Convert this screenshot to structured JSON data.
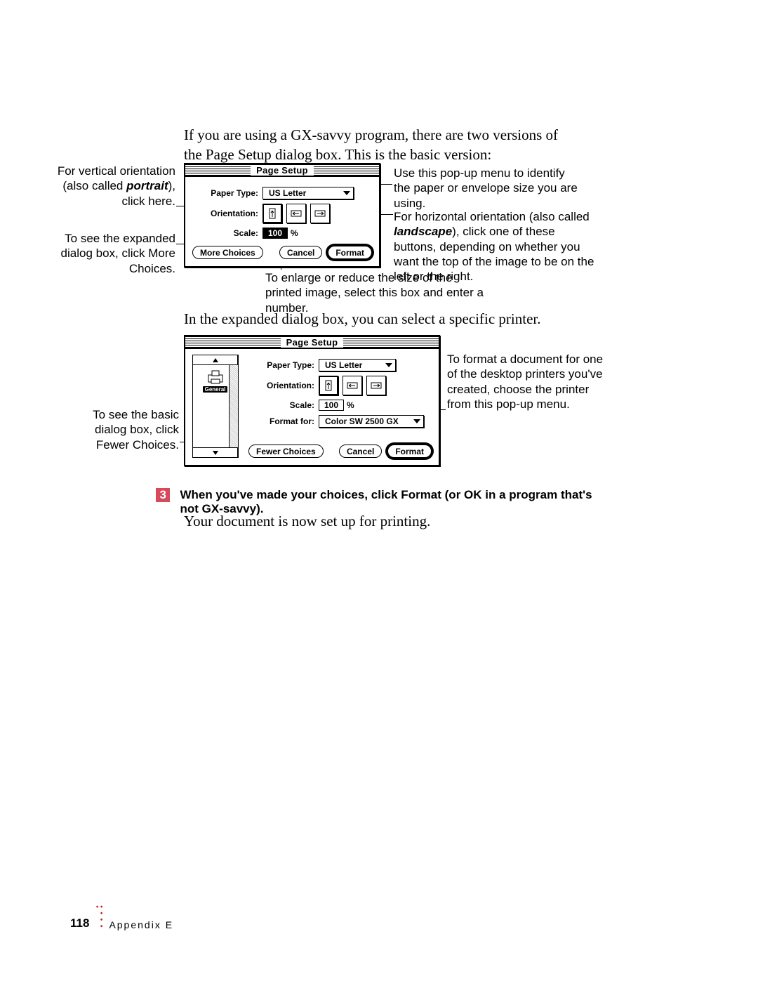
{
  "intro": "If you are using a GX-savvy program, there are two versions of the Page Setup dialog box. This is the basic version:",
  "callouts": {
    "portrait_pre": "For vertical orientation (also called ",
    "portrait_em": "portrait",
    "portrait_post": "), click here.",
    "more_choices": "To see the expanded dialog box, click More Choices.",
    "paper_popup": "Use this pop-up menu to identify the paper or envelope size you are using.",
    "landscape_pre": "For horizontal orientation (also called ",
    "landscape_em": "landscape",
    "landscape_post": "), click one of these buttons, depending on  whether you want the top of the image to be on the left or the right.",
    "scale_note": "To enlarge or reduce the size of the printed image, select this box and enter a number.",
    "format_for": "To format a document for one of the desktop printers you've created, choose the printer from this pop-up menu.",
    "fewer_choices": "To see the basic dialog box, click Fewer Choices."
  },
  "dialog1": {
    "title": "Page Setup",
    "paper_type_label": "Paper Type:",
    "paper_type_value": "US Letter",
    "orientation_label": "Orientation:",
    "scale_label": "Scale:",
    "scale_value": "100",
    "scale_pct": "%",
    "more_choices_btn": "More Choices",
    "cancel_btn": "Cancel",
    "format_btn": "Format"
  },
  "mid_text": "In the expanded dialog box, you can select a specific printer.",
  "dialog2": {
    "title": "Page Setup",
    "sidebar_item": "General",
    "paper_type_label": "Paper Type:",
    "paper_type_value": "US Letter",
    "orientation_label": "Orientation:",
    "scale_label": "Scale:",
    "scale_value": "100",
    "scale_pct": "%",
    "format_for_label": "Format for:",
    "format_for_value": "Color SW 2500 GX",
    "fewer_choices_btn": "Fewer Choices",
    "cancel_btn": "Cancel",
    "format_btn": "Format"
  },
  "step": {
    "num": "3",
    "text": "When you've made your choices, click Format (or OK in a program that's not GX-savvy)."
  },
  "outro": "Your document is now set up for printing.",
  "footer": {
    "page": "118",
    "section": "Appendix E"
  }
}
